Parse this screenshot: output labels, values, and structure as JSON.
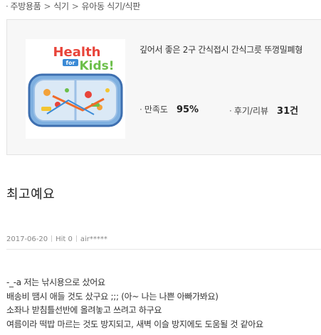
{
  "breadcrumb": {
    "items": [
      "주방용품",
      "식기",
      "유아동 식기/식판"
    ],
    "separator": ">"
  },
  "product": {
    "name": "깊어서 좋은 2구 간식접시 간식그릇 뚜껑밀폐형",
    "image_text": "Health for Kids!",
    "satisfaction_label": "만족도",
    "satisfaction_value": "95%",
    "reviews_label": "후기/리뷰",
    "reviews_value": "31건"
  },
  "review": {
    "title": "최고예요",
    "date": "2017-06-20",
    "hit": "Hit 0",
    "author": "air*****",
    "lines": [
      "-_-a 저는 낚시용으로 샀어요",
      "배송비 땜시 애들 것도 샀구요 ;;; (아~ 나는 나쁜 아빠가봐요)",
      "소좌나 받침틀선반에 올려놓고 쓰려고 하구요",
      "여름이라 떡밥 마르는 것도 방지되고, 새벽 이슬 방지에도 도움될 것 같아요"
    ]
  },
  "colors": {
    "box_bg": "#f7f7f7",
    "text": "#333333",
    "meta": "#888888"
  }
}
